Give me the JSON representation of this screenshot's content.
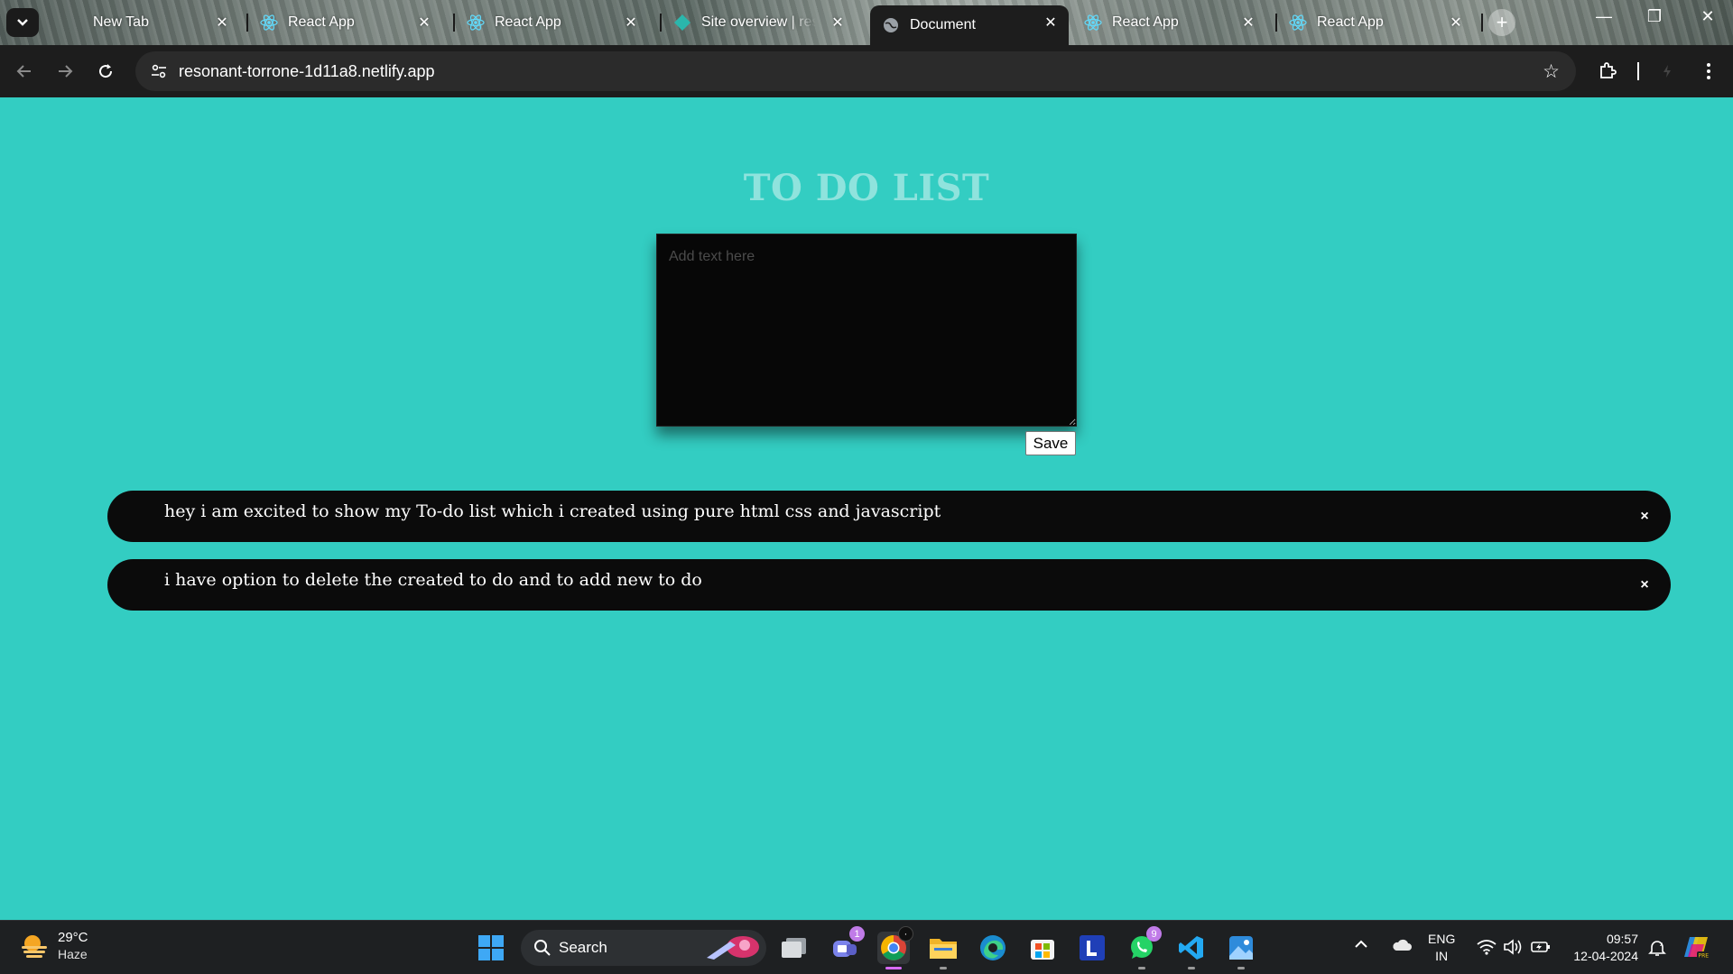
{
  "browser": {
    "tabs": [
      {
        "title": "New Tab",
        "favicon": "none"
      },
      {
        "title": "React App",
        "favicon": "react-icon"
      },
      {
        "title": "React App",
        "favicon": "react-icon"
      },
      {
        "title": "Site overview | reson",
        "favicon": "netlify-icon"
      },
      {
        "title": "Document",
        "favicon": "globe-icon",
        "active": true
      },
      {
        "title": "React App",
        "favicon": "react-icon"
      },
      {
        "title": "React App",
        "favicon": "react-icon"
      }
    ],
    "url": "resonant-torrone-1d11a8.netlify.app"
  },
  "page": {
    "title": "TO DO LIST",
    "textarea_placeholder": "Add text here",
    "save_label": "Save",
    "todos": [
      {
        "text": "hey i am excited to show my To-do list which i created using pure html css and javascript",
        "delete_label": "×"
      },
      {
        "text": "i have option to delete the created to do and to add new to do",
        "delete_label": "×"
      }
    ]
  },
  "taskbar": {
    "weather": {
      "temp": "29°C",
      "condition": "Haze"
    },
    "search_label": "Search",
    "pinned": [
      "start-icon",
      "search",
      "task-view-icon",
      "teams-icon",
      "chrome-icon",
      "file-explorer-icon",
      "edge-icon",
      "store-icon",
      "l-app-icon",
      "whatsapp-icon",
      "vscode-icon",
      "photos-icon"
    ],
    "teams_badge": "1",
    "whatsapp_badge": "9",
    "language": {
      "line1": "ENG",
      "line2": "IN"
    },
    "time": "09:57",
    "date": "12-04-2024"
  },
  "colors": {
    "page_bg": "#33cdc2",
    "title": "#8fe3dd",
    "todo_bg": "#0b0b0b"
  }
}
